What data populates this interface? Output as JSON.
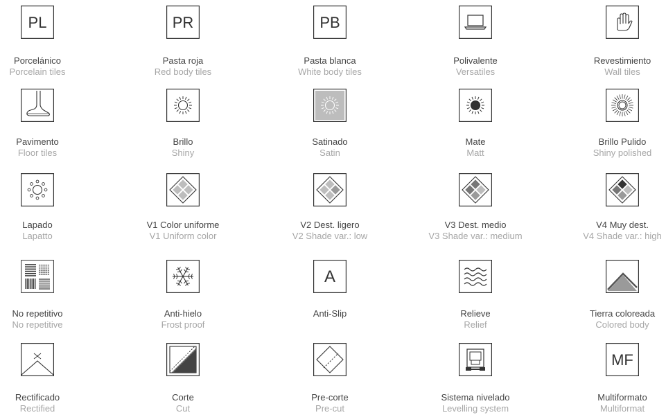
{
  "colors": {
    "stroke": "#333333",
    "label": "#444444",
    "sublabel": "#a6a6a6",
    "fill_light": "#bdbdbd",
    "fill_mid": "#9a9a9a",
    "fill_dark": "#333333"
  },
  "icons": [
    {
      "icon": "pl-text-icon",
      "text": "PL",
      "label": "Porcelánico",
      "sublabel": "Porcelain tiles"
    },
    {
      "icon": "pr-text-icon",
      "text": "PR",
      "label": "Pasta roja",
      "sublabel": "Red body tiles"
    },
    {
      "icon": "pb-text-icon",
      "text": "PB",
      "label": "Pasta blanca",
      "sublabel": "White body tiles"
    },
    {
      "icon": "laptop-icon",
      "label": "Polivalente",
      "sublabel": "Versatiles"
    },
    {
      "icon": "hand-icon",
      "label": "Revestimiento",
      "sublabel": "Wall tiles"
    },
    {
      "icon": "foot-icon",
      "label": "Pavimento",
      "sublabel": "Floor tiles"
    },
    {
      "icon": "sun-outline-icon",
      "label": "Brillo",
      "sublabel": "Shiny"
    },
    {
      "icon": "sun-grey-background-icon",
      "label": "Satinado",
      "sublabel": "Satin"
    },
    {
      "icon": "sun-filled-icon",
      "label": "Mate",
      "sublabel": "Matt"
    },
    {
      "icon": "sun-rays-icon",
      "label": "Brillo Pulido",
      "sublabel": "Shiny polished"
    },
    {
      "icon": "dotted-circle-icon",
      "label": "Lapado",
      "sublabel": "Lapatto"
    },
    {
      "icon": "diamond-v1-icon",
      "label": "V1 Color uniforme",
      "sublabel": "V1 Uniform color"
    },
    {
      "icon": "diamond-v2-icon",
      "label": "V2 Dest. ligero",
      "sublabel": "V2 Shade var.: low"
    },
    {
      "icon": "diamond-v3-icon",
      "label": "V3 Dest. medio",
      "sublabel": "V3 Shade var.: medium"
    },
    {
      "icon": "diamond-v4-icon",
      "label": "V4 Muy dest.",
      "sublabel": "V4 Shade var.: high"
    },
    {
      "icon": "pattern-grid-icon",
      "label": "No repetitivo",
      "sublabel": "No repetitive"
    },
    {
      "icon": "snowflake-icon",
      "label": "Anti-hielo",
      "sublabel": "Frost proof"
    },
    {
      "icon": "a-text-icon",
      "text": "A",
      "label": "Anti-Slip",
      "sublabel": ""
    },
    {
      "icon": "waves-icon",
      "label": "Relieve",
      "sublabel": "Relief"
    },
    {
      "icon": "mountain-icon",
      "label": "Tierra coloreada",
      "sublabel": "Colored body"
    },
    {
      "icon": "rectified-edge-icon",
      "label": "Rectificado",
      "sublabel": "Rectified"
    },
    {
      "icon": "cut-icon",
      "label": "Corte",
      "sublabel": "Cut"
    },
    {
      "icon": "pre-cut-icon",
      "label": "Pre-corte",
      "sublabel": "Pre-cut"
    },
    {
      "icon": "levelling-system-icon",
      "label": "Sistema nivelado",
      "sublabel": "Levelling system"
    },
    {
      "icon": "mf-text-icon",
      "text": "MF",
      "label": "Multiformato",
      "sublabel": "Multiformat"
    }
  ]
}
